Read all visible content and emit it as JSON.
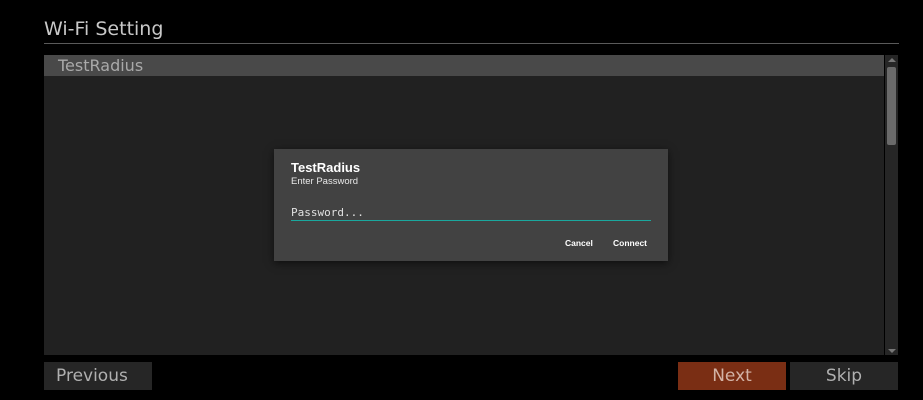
{
  "header": {
    "title": "Wi-Fi Setting"
  },
  "network_list": {
    "items": [
      {
        "ssid": "TestRadius"
      }
    ]
  },
  "dialog": {
    "title": "TestRadius",
    "message": "Enter Password",
    "password_placeholder": "Password...",
    "password_value": "",
    "cancel_label": "Cancel",
    "connect_label": "Connect",
    "accent_color": "#1aa89e"
  },
  "footer": {
    "previous_label": "Previous",
    "next_label": "Next",
    "skip_label": "Skip",
    "next_color": "#7a2e14"
  }
}
